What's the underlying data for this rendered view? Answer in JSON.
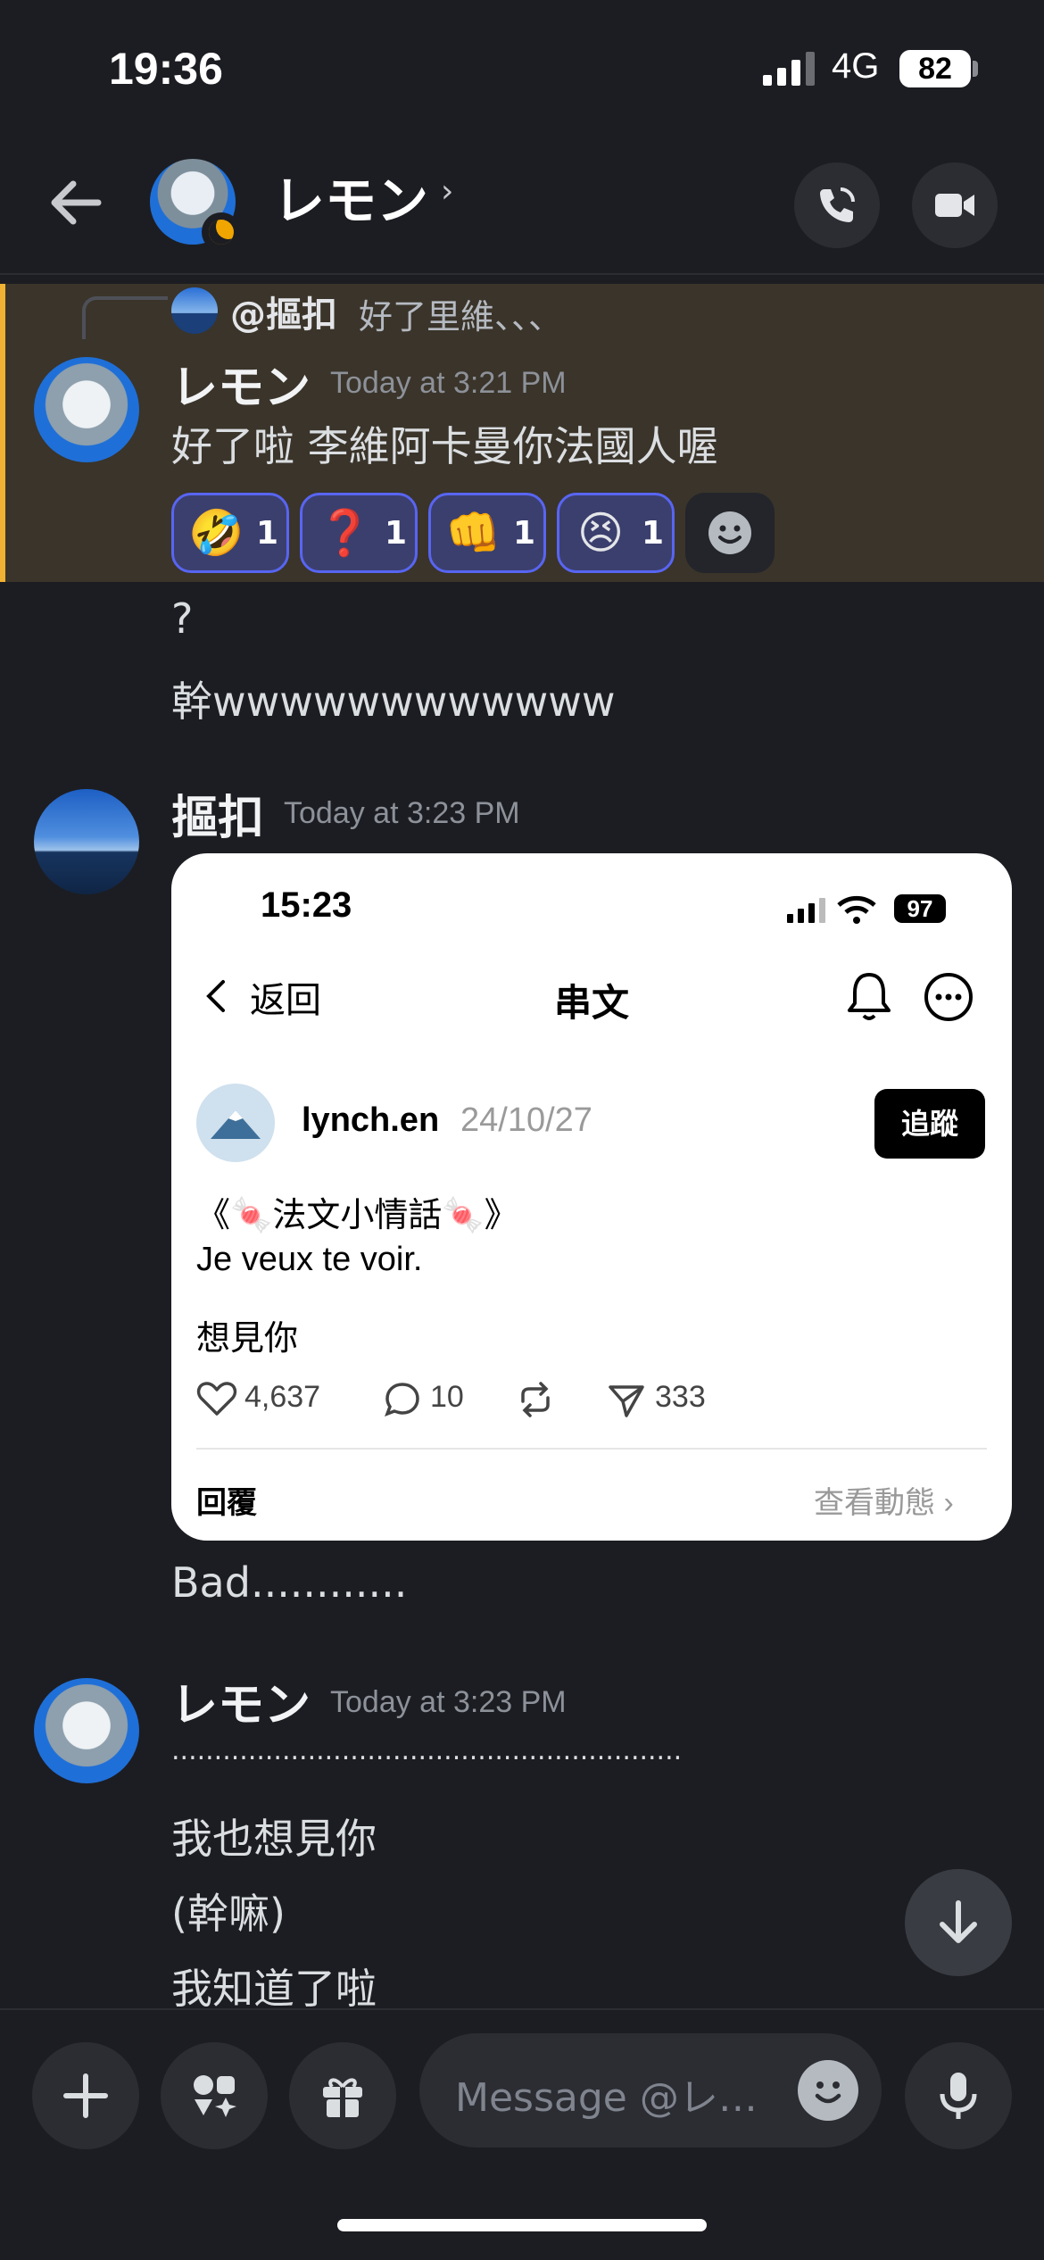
{
  "status_bar": {
    "time": "19:36",
    "network": "4G",
    "battery": "82"
  },
  "header": {
    "contact_name": "レモン",
    "chevron": "›"
  },
  "reply_ref": {
    "author": "@摳扣",
    "snippet": "好了里維、、、"
  },
  "messages": [
    {
      "author": "レモン",
      "time": "Today at 3:21 PM",
      "text": "好了啦 李維阿卡曼你法國人喔"
    },
    {
      "text": "?"
    },
    {
      "text": "幹wwwwwwwwwwww"
    },
    {
      "author": "摳扣",
      "time": "Today at 3:23 PM"
    },
    {
      "text": "Bad............"
    },
    {
      "author": "レモン",
      "time": "Today at 3:23 PM",
      "text": "............................................................"
    },
    {
      "text": "我也想見你"
    },
    {
      "text": "(幹嘛)"
    },
    {
      "text": "我知道了啦"
    }
  ],
  "reactions": [
    {
      "emoji": "🤣",
      "count": "1"
    },
    {
      "emoji": "❓",
      "count": "1"
    },
    {
      "emoji": "👊",
      "count": "1"
    },
    {
      "emoji": "😣",
      "count": "1"
    }
  ],
  "embed": {
    "time": "15:23",
    "battery": "97",
    "back_label": "返回",
    "title": "串文",
    "username": "lynch.en",
    "date": "24/10/27",
    "follow_label": "追蹤",
    "line1": "《🍬法文小情話🍬》",
    "line2": "Je veux te voir.",
    "line3": "想見你",
    "likes": "4,637",
    "comments": "10",
    "shares": "333",
    "reply_label": "回覆",
    "view_label": "查看動態 ›"
  },
  "composer": {
    "placeholder": "Message @レ…"
  },
  "colors": {
    "background": "#1c1d22",
    "highlight": "#3a342a",
    "accent": "#5865f2",
    "mention_bar": "#f0b232"
  }
}
